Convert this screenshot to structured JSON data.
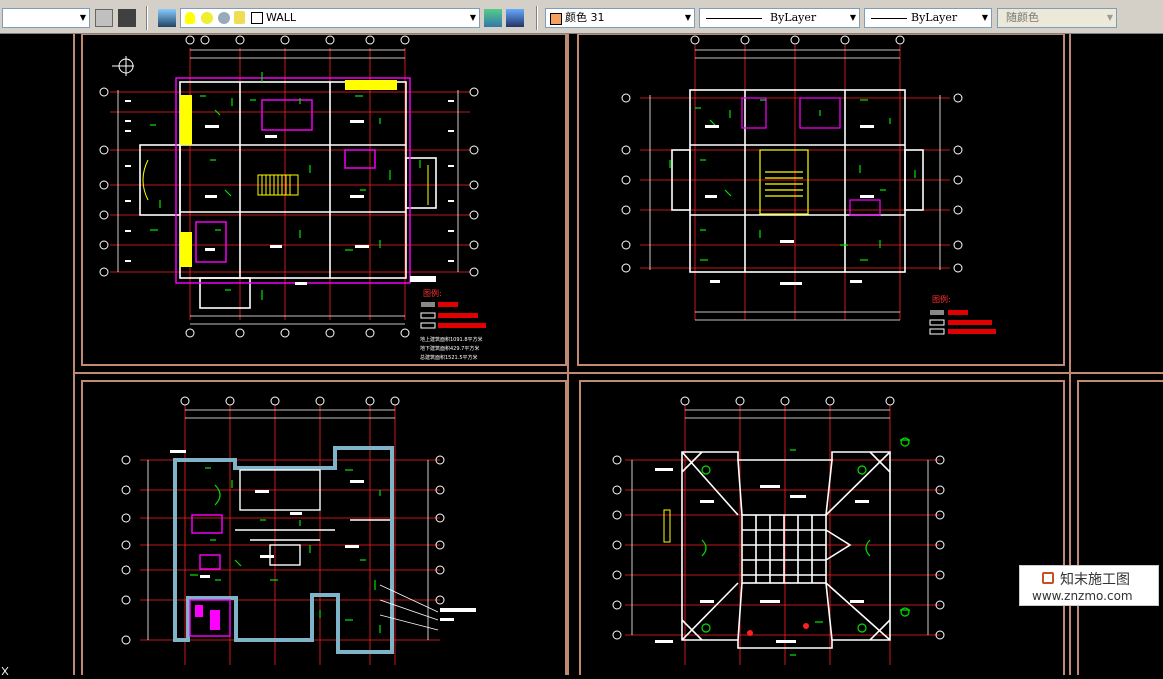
{
  "toolbar": {
    "layer_name": "WALL",
    "color_label": "颜色 31",
    "linetype": "ByLayer",
    "lineweight": "ByLayer",
    "plotstyle": "随颜色"
  },
  "legend_left": {
    "title": "图例:",
    "notes": [
      "地上建筑面积1091.8平方米",
      "地下建筑面积429.7平方米",
      "总建筑面积1521.5平方米"
    ]
  },
  "legend_right": {
    "title": "图例:"
  },
  "watermark": {
    "name": "知末施工图",
    "url": "www.znzmo.com"
  },
  "colors": {
    "frame": "#c08a72",
    "grid": "#ff2020",
    "wall": "#ffffff",
    "fixture": "#00e000",
    "furniture": "#ff00ff",
    "accent": "#ffff00",
    "dim": "#ffffff",
    "boundary": "#7fb3c8"
  }
}
